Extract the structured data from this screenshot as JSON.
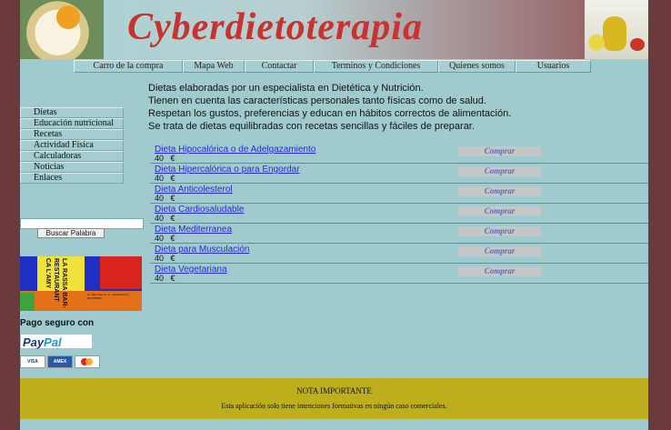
{
  "site_title": "Cyberdietoterapia",
  "top_nav": [
    "Carro de la compra",
    "Mapa Web",
    "Contactar",
    "Terminos y Condiciones",
    "Quienes somos",
    "Usuarios"
  ],
  "intro_lines": [
    "Dietas elaboradas por un especialista en Dietética y Nutrición.",
    "Tienen en cuenta las características personales tanto físicas como de salud.",
    "Respetan los gustos, preferencias y educan en hábitos correctos de alimentación.",
    "Se trata de dietas equilibradas con recetas sencillas y fáciles de preparar."
  ],
  "side_menu": [
    "Dietas",
    "Educación nutricional",
    "Recetas",
    "Actividad Física",
    "Calculadoras",
    "Noticias",
    "Enlaces"
  ],
  "search": {
    "value": "",
    "button_label": "Buscar Palabra"
  },
  "banner": {
    "name": "LA RASSA BAR-RESTAURANT CA L'AMY",
    "info": "C/. Sant Ramon, 6 · Castellvell Tel. 93/2785661"
  },
  "payment": {
    "title": "Pago seguro con",
    "paypal_pay": "Pay",
    "paypal_pal": "Pal",
    "cards": [
      "VISA",
      "AMEX",
      "MasterCard"
    ]
  },
  "products": [
    {
      "name": "Dieta Hipocalórica o de Adelgazamiento",
      "price": "40   €",
      "buy_label": "Comprar"
    },
    {
      "name": "Dieta Hipercalórica o para Engordar",
      "price": "40   €",
      "buy_label": "Comprar"
    },
    {
      "name": "Dieta Anticolesterol",
      "price": "40   €",
      "buy_label": "Comprar"
    },
    {
      "name": "Dieta Cardiosaludable",
      "price": "40   €",
      "buy_label": "Comprar"
    },
    {
      "name": "Dieta Mediterranea",
      "price": "40   €",
      "buy_label": "Comprar"
    },
    {
      "name": "Dieta para Musculación",
      "price": "40   €",
      "buy_label": "Comprar"
    },
    {
      "name": "Dieta Vegetariana",
      "price": "40   €",
      "buy_label": "Comprar"
    }
  ],
  "footer": {
    "title": "NOTA IMPORTANTE",
    "text": "Esta aplicación solo tiene intenciones formativas en ningún caso comerciales."
  },
  "colors": {
    "title": "#c8322f",
    "page_bg": "#9fcbcf",
    "outer_bg": "#6b3a3e",
    "footer_bg": "#bfae1b",
    "link": "#2a2ad9"
  }
}
